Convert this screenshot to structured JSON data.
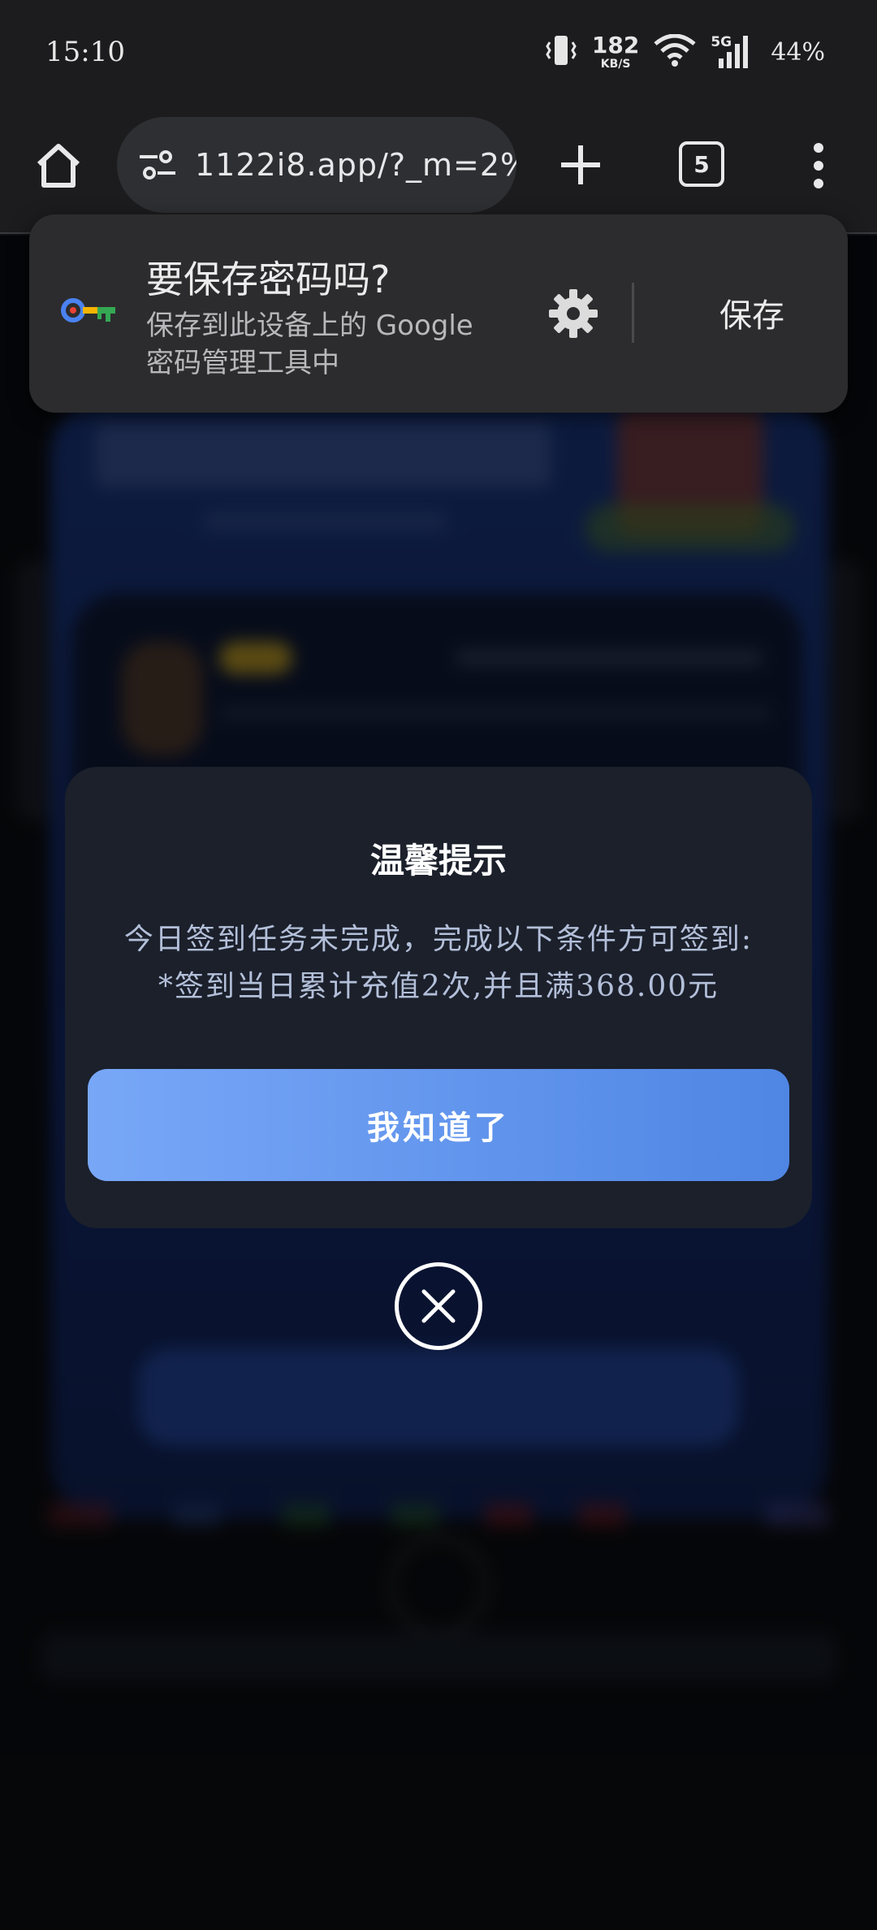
{
  "status_bar": {
    "time": "15:10",
    "net_speed_value": "182",
    "net_speed_unit": "KB/S",
    "network_type": "5G",
    "battery": "44%"
  },
  "browser": {
    "url": "1122i8.app/?_m=2%",
    "tab_count": "5"
  },
  "password_prompt": {
    "title": "要保存密码吗?",
    "description": "保存到此设备上的 Google 密码管理工具中",
    "save_label": "保存"
  },
  "dialog": {
    "title": "温馨提示",
    "message_line1": "今日签到任务未完成，完成以下条件方可签到:",
    "message_line2": "*签到当日累计充值2次,并且满368.00元",
    "confirm_label": "我知道了"
  },
  "colors": {
    "dialog_bg": "#1b202b",
    "button_gradient_start": "#78a7f7",
    "button_gradient_end": "#4f86e4",
    "prompt_bg": "#2c2c2e"
  },
  "icons": {
    "home": "home-icon",
    "tune": "tune-icon",
    "plus": "plus-icon",
    "menu": "more-vert-icon",
    "key": "key-icon",
    "gear": "gear-icon",
    "close": "close-icon"
  }
}
